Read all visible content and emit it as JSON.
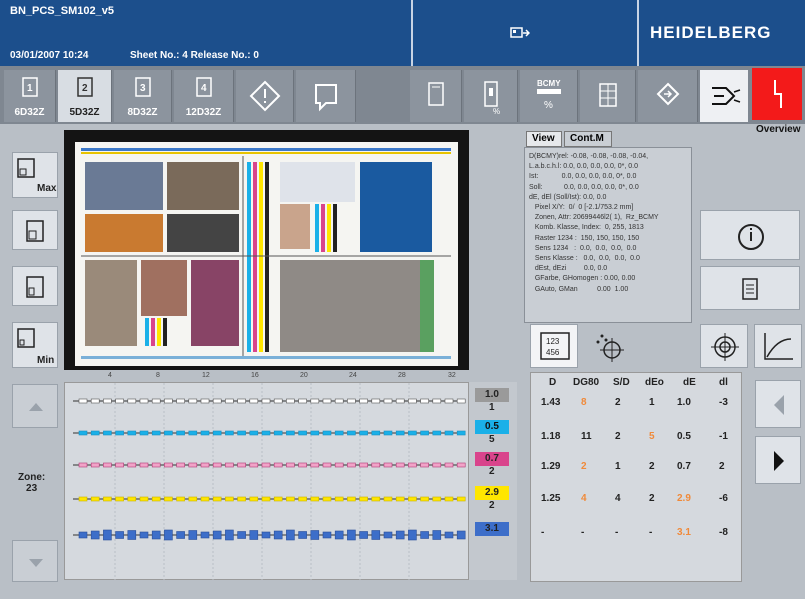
{
  "header": {
    "job": "BN_PCS_SM102_v5",
    "datetime": "03/01/2007  10:24",
    "sheet_release": "Sheet No.: 4   Release No.: 0",
    "brand": "HEIDELBERG",
    "network_icon": "network-icon"
  },
  "toolbar": {
    "units": [
      {
        "label": "6D32Z",
        "num": "1"
      },
      {
        "label": "5D32Z",
        "num": "2",
        "selected": true
      },
      {
        "label": "8D32Z",
        "num": "3"
      },
      {
        "label": "12D32Z",
        "num": "4"
      }
    ],
    "overview_label": "Overview",
    "bcmy_text": "BCMY",
    "pct_text": "%"
  },
  "left_sizes": {
    "max_label": "Max",
    "min_label": "Min"
  },
  "info_tabs": {
    "view": "View",
    "contm": "Cont.M"
  },
  "info_text": "D(BCMY)rel: -0.08, -0.08, -0.08, -0.04,\nL.a.b.c.h.l: 0.0, 0.0, 0.0, 0.0, 0*, 0.0\nIst:            0.0, 0.0, 0.0, 0.0, 0*, 0.0\nSoll:           0.0, 0.0, 0.0, 0.0, 0*, 0.0\ndE, dEl (Soll/Ist): 0.0, 0.0\n   Pixel X/Y:  0/  0 [-2.1/753.2 mm]\n   Zonen, Attr: 20699446l2( 1),  Rz_BCMY\n   Komb. Klasse, Index:  0, 255, 1813\n   Raster 1234 :  150, 150, 150, 150\n   Sens 1234   :  0.0,  0.0,  0.0,  0.0\n   Sens Klasse :   0.0,  0.0,  0.0,  0.0\n   dEst, dEzi         0.0, 0.0\n   GFarbe, GHomogen : 0.00, 0.00\n   GAuto, GMan          0.00  1.00",
  "zones": {
    "ticks": [
      "4",
      "8",
      "12",
      "16",
      "20",
      "24",
      "28",
      "32"
    ],
    "zone_label": "Zone:",
    "zone_value": "23"
  },
  "inks": [
    {
      "value": "1.0",
      "zone": "1",
      "color": "#9a9a9a"
    },
    {
      "value": "0.5",
      "zone": "5",
      "color": "#1ab0e8"
    },
    {
      "value": "0.7",
      "zone": "2",
      "color": "#d9448c"
    },
    {
      "value": "2.9",
      "zone": "2",
      "color": "#ffe600"
    },
    {
      "value": "3.1",
      "zone": "",
      "color": "#3d6ec9"
    }
  ],
  "measure": {
    "headers": [
      "D",
      "DG80",
      "S/D",
      "dEo",
      "dE",
      "dl"
    ],
    "rows": [
      [
        "1.43",
        "8",
        "2",
        "1",
        "1.0",
        "-3"
      ],
      [
        "1.18",
        "11",
        "2",
        "5",
        "0.5",
        "-1"
      ],
      [
        "1.29",
        "2",
        "1",
        "2",
        "0.7",
        "2"
      ],
      [
        "1.25",
        "4",
        "4",
        "2",
        "2.9",
        "-6"
      ],
      [
        "-",
        "-",
        "-",
        "-",
        "3.1",
        "-8"
      ]
    ],
    "orange_cells": [
      [
        0,
        1
      ],
      [
        1,
        3
      ],
      [
        2,
        1
      ],
      [
        3,
        1
      ],
      [
        3,
        4
      ],
      [
        4,
        4
      ]
    ],
    "accent_orange": "#f08a3a"
  },
  "colors": {
    "header_blue": "#1c4f8c",
    "alert_red": "#f31a1a",
    "panel_gray": "#b9bfc6"
  }
}
